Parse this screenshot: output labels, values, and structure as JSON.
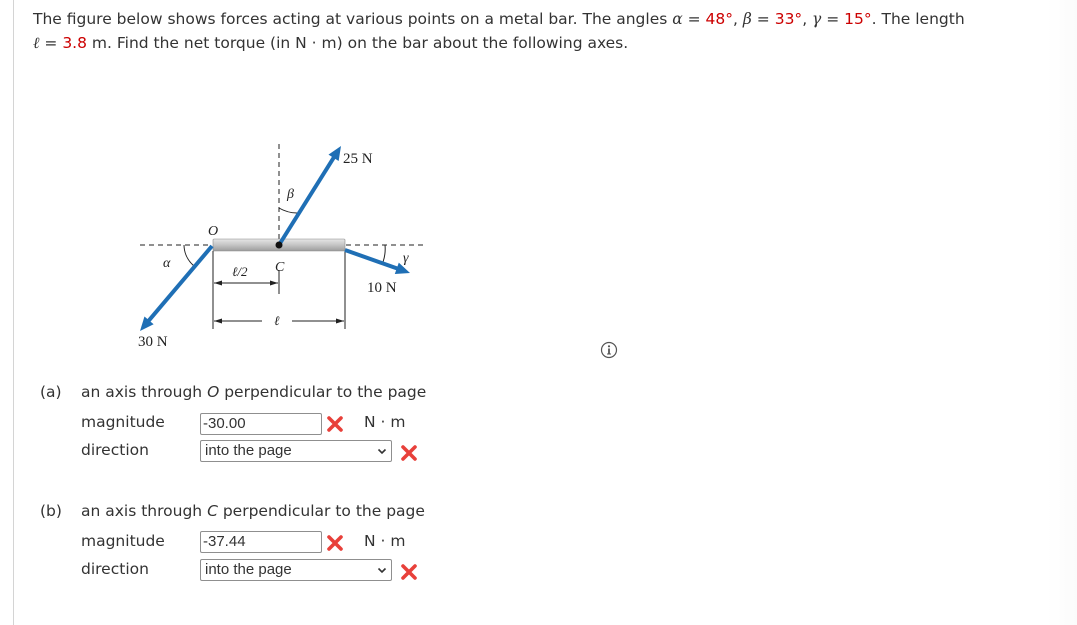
{
  "question": {
    "intro": "The figure below shows forces acting at various points on a metal bar. The angles ",
    "alpha_sym": "α",
    "eq1": " = ",
    "alpha_val": "48°",
    "sep1": ", ",
    "beta_sym": "β",
    "eq2": " = ",
    "beta_val": "33°",
    "sep2": ", ",
    "gamma_sym": "γ",
    "eq3": " = ",
    "gamma_val": "15°",
    "mid": ". The length ",
    "ell_sym": "ℓ",
    "eq4": " = ",
    "ell_val": "3.8",
    "outro": " m. Find the net torque (in N · m) on the bar about the following axes."
  },
  "figure": {
    "label_O": "O",
    "label_C": "C",
    "label_alpha": "α",
    "label_beta": "β",
    "label_gamma": "γ",
    "force_30": "30 N",
    "force_25": "25 N",
    "force_10": "10 N",
    "dim_half": "ℓ/2",
    "dim_full": "ℓ",
    "arrow_color": "#1f6fb5"
  },
  "info_icon": "info-icon",
  "parts": [
    {
      "label": "(a)",
      "text_pre": "an axis through ",
      "axis_point": "O",
      "text_post": " perpendicular to the page",
      "magnitude_label": "magnitude",
      "magnitude_value": "-30.00",
      "magnitude_status": "incorrect",
      "unit": "N · m",
      "direction_label": "direction",
      "direction_value": "into the page",
      "direction_status": "incorrect"
    },
    {
      "label": "(b)",
      "text_pre": "an axis through ",
      "axis_point": "C",
      "text_post": " perpendicular to the page",
      "magnitude_label": "magnitude",
      "magnitude_value": "-37.44",
      "magnitude_status": "incorrect",
      "unit": "N · m",
      "direction_label": "direction",
      "direction_value": "into the page",
      "direction_status": "incorrect"
    }
  ],
  "colors": {
    "given_value": "#cc0000",
    "incorrect_mark": "#e8403a"
  }
}
